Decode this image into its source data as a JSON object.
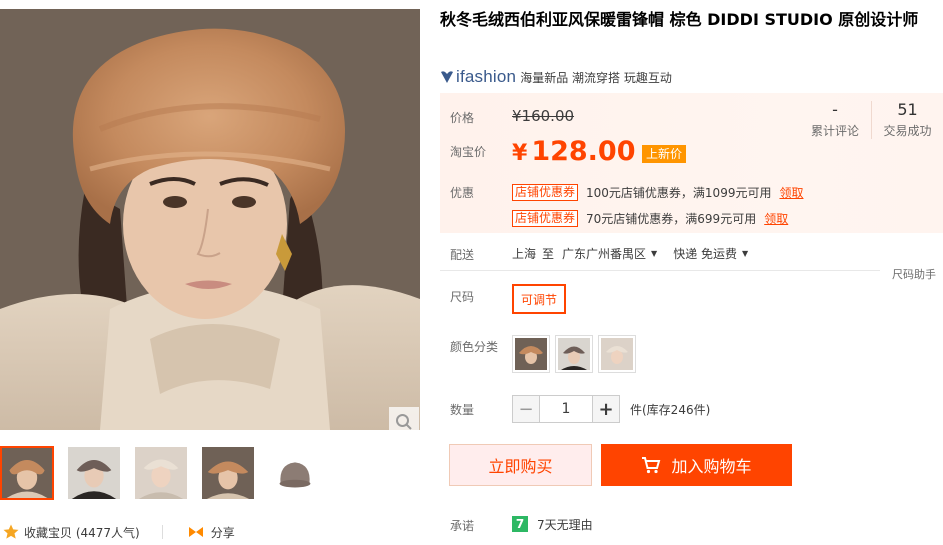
{
  "product": {
    "title": "秋冬毛绒西伯利亚风保暖雷锋帽 棕色 DIDDI STUDIO 原创设计师",
    "brand_logo": "ifashion",
    "brand_tags": "海量新品 潮流穿搭 玩趣互动"
  },
  "price": {
    "orig_label": "价格",
    "orig_price": "¥160.00",
    "taobao_label": "淘宝价",
    "currency": "¥",
    "current": "128.00",
    "badge": "上新价",
    "promo_label": "优惠",
    "coupons": [
      {
        "tag": "店铺优惠券",
        "text": "100元店铺优惠券，满1099元可用",
        "link": "领取"
      },
      {
        "tag": "店铺优惠券",
        "text": "70元店铺优惠券，满699元可用",
        "link": "领取"
      }
    ]
  },
  "stats": [
    {
      "value": "-",
      "label": "累计评论"
    },
    {
      "value": "51",
      "label": "交易成功"
    }
  ],
  "shipping": {
    "label": "配送",
    "from": "上海",
    "to_word": "至",
    "destination": "广东广州番禺区",
    "method": "快递 免运费"
  },
  "size_helper": "尺码助手",
  "size": {
    "label": "尺码",
    "option": "可调节"
  },
  "color": {
    "label": "颜色分类"
  },
  "quantity": {
    "label": "数量",
    "value": "1",
    "minus": "−",
    "plus": "+",
    "stock": "件(库存246件)"
  },
  "actions": {
    "buy_now": "立即购买",
    "add_to_cart": "加入购物车"
  },
  "promise": {
    "label": "承诺",
    "icon_text": "7",
    "text": "7天无理由"
  },
  "gallery": {
    "favorite": "收藏宝贝 (4477人气)",
    "share": "分享"
  },
  "colors": {
    "accent": "#ff4400",
    "badge": "#ff9500",
    "fur": "#c89068",
    "coat": "#d8c8b4",
    "brand_blue": "#3a5a8c"
  }
}
